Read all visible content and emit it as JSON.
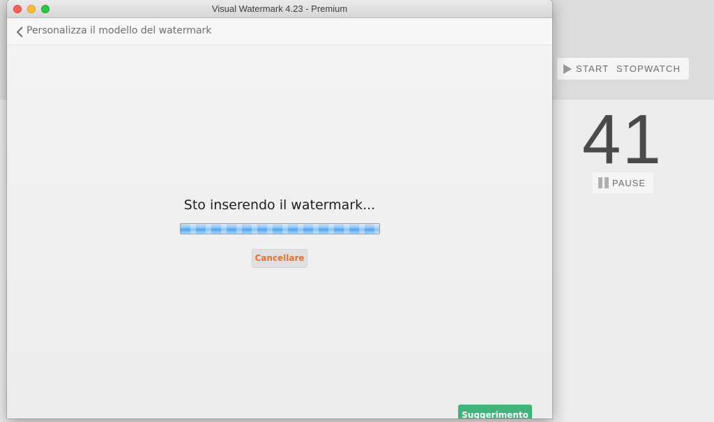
{
  "stopwatch": {
    "start_label": "START STOPWATCH",
    "count": "41",
    "pause_label": "PAUSE"
  },
  "window": {
    "title": "Visual Watermark 4.23 - Premium"
  },
  "nav": {
    "back_label": "Personalizza il modello del watermark"
  },
  "main": {
    "status_text": "Sto inserendo il watermark...",
    "progress": 1.0,
    "cancel_label": "Cancellare",
    "suggest_label": "Suggerimento"
  },
  "colors": {
    "accent_orange": "#e8702a",
    "suggest_green": "#3fb47a",
    "progress_blue": "#4aa3ef"
  }
}
